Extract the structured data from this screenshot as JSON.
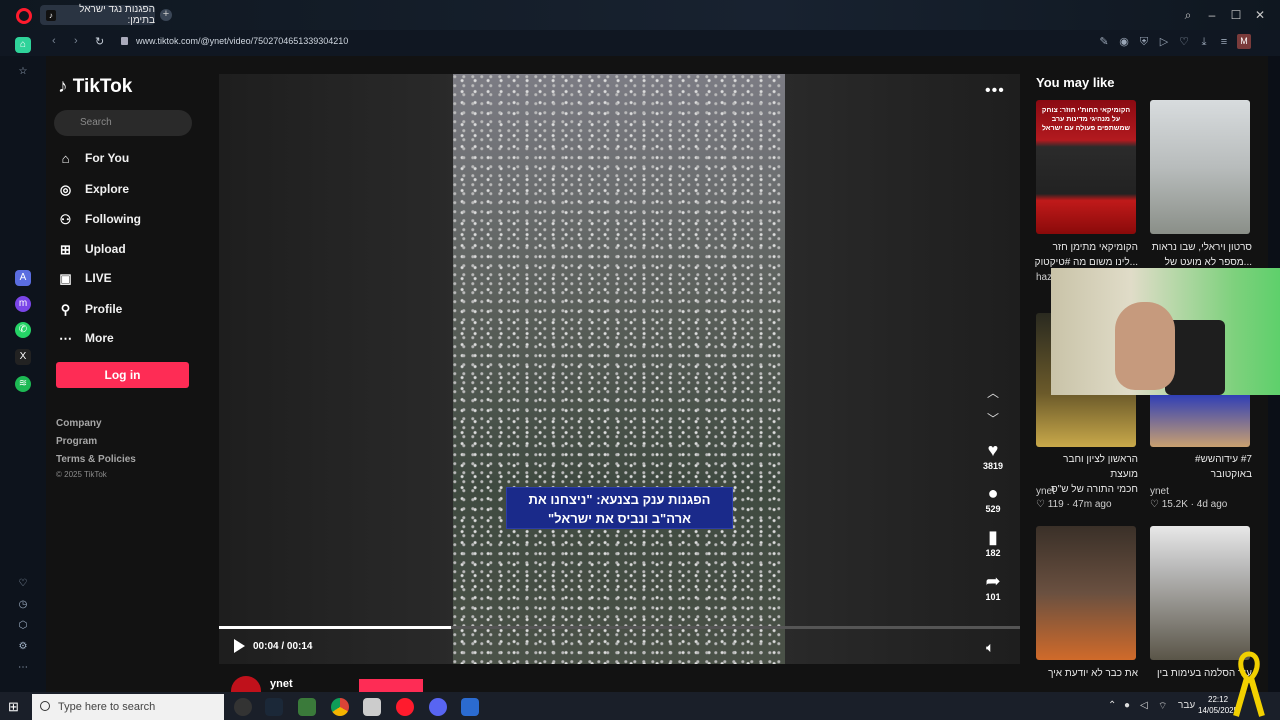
{
  "browser": {
    "tab_title": "הפגנות נגד ישראל בתימן:",
    "url": "www.tiktok.com/@ynet/video/7502704651339304210",
    "profile_initial": "M"
  },
  "tiktok": {
    "logo": "TikTok",
    "search_placeholder": "Search",
    "nav": [
      {
        "label": "For You",
        "icon": "home-icon"
      },
      {
        "label": "Explore",
        "icon": "compass-icon"
      },
      {
        "label": "Following",
        "icon": "following-icon"
      },
      {
        "label": "Upload",
        "icon": "upload-icon"
      },
      {
        "label": "LIVE",
        "icon": "live-icon"
      },
      {
        "label": "Profile",
        "icon": "profile-icon"
      },
      {
        "label": "More",
        "icon": "more-icon"
      }
    ],
    "login_label": "Log in",
    "footer": {
      "company": "Company",
      "program": "Program",
      "terms": "Terms & Policies",
      "copyright": "© 2025 TikTok"
    }
  },
  "video": {
    "caption": "הפגנות ענק בצנעא: \"ניצחנו את ארה\"ב ונביס את ישראל\"",
    "caption_line1": "הפגנות ענק בצנעא: \"ניצחנו את",
    "caption_line2": "ארה\"ב ונביס את ישראל\"",
    "time": "00:04 / 00:14",
    "progress": 0.29,
    "likes": "3819",
    "comments": "529",
    "saves": "182",
    "shares": "101",
    "author": "ynet"
  },
  "you_may_like": {
    "title": "You may like",
    "cards": [
      {
        "title_line1": "הקומיקאי מתימן חזר",
        "title_line2": "...לינו משום מה #טיקטוק",
        "author": "haz",
        "thumb_text": "הקומיקאי החות'י חוזר: צוחק על מנהיגי מדינות ערב שמשתפים פעולה עם ישראל"
      },
      {
        "title_line1": "סרטון ויראלי, שבו נראות",
        "title_line2": "...מספר לא מועט של",
        "author": "",
        "thumb_text": ""
      },
      {
        "title_line1": "הראשון לציון וחבר מועצת",
        "title_line2": "חכמי התורה של ש\"ס",
        "author": "ynet",
        "likes": "119",
        "time": "47m ago"
      },
      {
        "title_line1": "#7 עידוהשש#",
        "title_line2": "באוקטובר",
        "author": "ynet",
        "likes": "15.2K",
        "time": "4d ago"
      },
      {
        "title_line1": "את כבר לא יודעת איך",
        "title_line2": "",
        "author": "",
        "thumb_text": ""
      },
      {
        "title_line1": "עוד הסלמה בעימות בין",
        "title_line2": "",
        "author": "",
        "thumb_text": ""
      }
    ]
  },
  "taskbar": {
    "search_placeholder": "Type here to search",
    "time": "22:12",
    "date": "14/05/2025",
    "lang": "עבר"
  },
  "colors": {
    "tiktok_red": "#fe2c55",
    "caption_blue": "#1a2a8a",
    "opera_red": "#ff1b2d"
  }
}
